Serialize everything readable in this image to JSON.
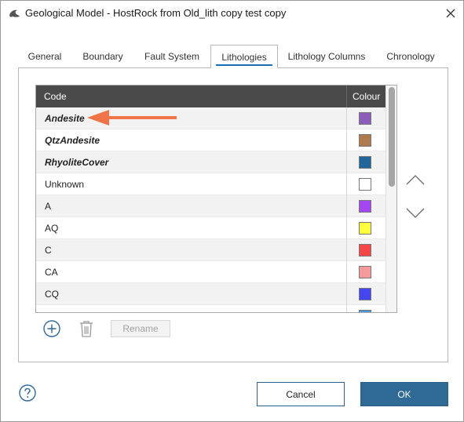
{
  "window": {
    "title": "Geological Model - HostRock from Old_lith copy test copy",
    "app_icon": "leapfrog-app-icon",
    "close_icon": "close-icon"
  },
  "tabs": [
    {
      "label": "General",
      "active": false
    },
    {
      "label": "Boundary",
      "active": false
    },
    {
      "label": "Fault System",
      "active": false
    },
    {
      "label": "Lithologies",
      "active": true
    },
    {
      "label": "Lithology Columns",
      "active": false
    },
    {
      "label": "Chronology",
      "active": false
    }
  ],
  "table": {
    "columns": [
      "Code",
      "Colour"
    ],
    "rows": [
      {
        "code": "Andesite",
        "colour": "#8b5cb8",
        "bold_italic": true,
        "highlighted": true
      },
      {
        "code": "QtzAndesite",
        "colour": "#b07a4f",
        "bold_italic": true,
        "highlighted": false
      },
      {
        "code": "RhyoliteCover",
        "colour": "#22669a",
        "bold_italic": true,
        "highlighted": false
      },
      {
        "code": "Unknown",
        "colour": "#ffffff",
        "bold_italic": false,
        "highlighted": false
      },
      {
        "code": "A",
        "colour": "#a347f0",
        "bold_italic": false,
        "highlighted": false
      },
      {
        "code": "AQ",
        "colour": "#ffff3d",
        "bold_italic": false,
        "highlighted": false
      },
      {
        "code": "C",
        "colour": "#f54646",
        "bold_italic": false,
        "highlighted": false
      },
      {
        "code": "CA",
        "colour": "#f59a9a",
        "bold_italic": false,
        "highlighted": false
      },
      {
        "code": "CQ",
        "colour": "#4646f0",
        "bold_italic": false,
        "highlighted": false
      },
      {
        "code": "",
        "colour": "#4a9ae0",
        "bold_italic": false,
        "highlighted": false
      }
    ]
  },
  "actions": {
    "add_icon": "add-circle-icon",
    "delete_icon": "trash-icon",
    "rename_label": "Rename",
    "move_up_icon": "chevron-up-icon",
    "move_down_icon": "chevron-down-icon"
  },
  "footer": {
    "help_icon": "help-icon",
    "cancel_label": "Cancel",
    "ok_label": "OK"
  },
  "annotation": {
    "arrow_icon": "callout-arrow-icon",
    "arrow_color": "#f07447"
  },
  "colors": {
    "accent": "#2f6a97",
    "header_bg": "#4a4a4a",
    "tab_underline": "#1a6fb3"
  }
}
